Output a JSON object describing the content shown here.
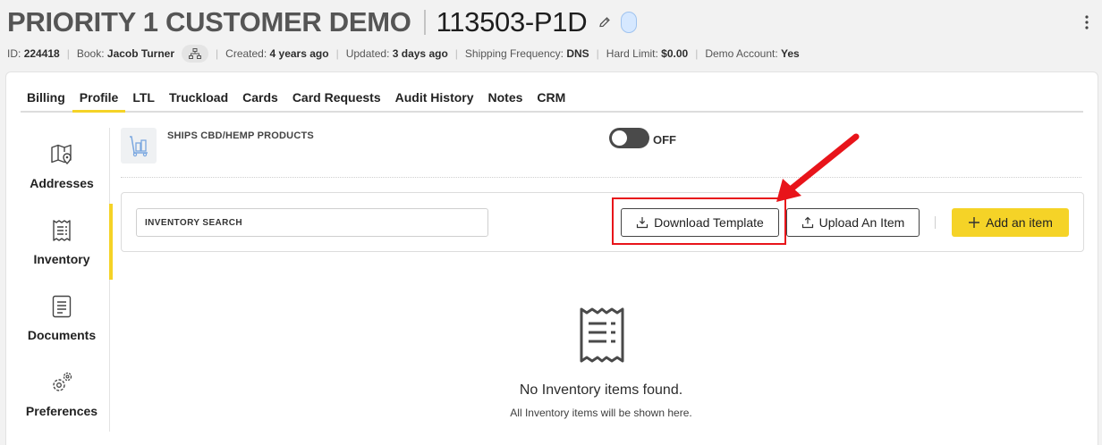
{
  "header": {
    "account_name": "PRIORITY 1 CUSTOMER DEMO",
    "account_code": "113503-P1D",
    "meta": [
      {
        "label": "ID:",
        "value": "224418"
      },
      {
        "label": "Book:",
        "value": "Jacob Turner"
      },
      {
        "label": "Created:",
        "value": "4 years ago"
      },
      {
        "label": "Updated:",
        "value": "3 days ago"
      },
      {
        "label": "Shipping Frequency:",
        "value": "DNS"
      },
      {
        "label": "Hard Limit:",
        "value": "$0.00"
      },
      {
        "label": "Demo Account:",
        "value": "Yes"
      }
    ]
  },
  "tabs": [
    "Billing",
    "Profile",
    "LTL",
    "Truckload",
    "Cards",
    "Card Requests",
    "Audit History",
    "Notes",
    "CRM"
  ],
  "active_tab": "Profile",
  "side_nav": [
    {
      "label": "Addresses",
      "icon": "map-pin-icon"
    },
    {
      "label": "Inventory",
      "icon": "receipt-icon"
    },
    {
      "label": "Documents",
      "icon": "document-icon"
    },
    {
      "label": "Preferences",
      "icon": "gears-icon"
    }
  ],
  "active_nav": "Inventory",
  "cbd": {
    "label": "SHIPS CBD/HEMP PRODUCTS",
    "toggle_state": "OFF",
    "icon": "hand-truck-icon"
  },
  "toolbar": {
    "search_placeholder": "INVENTORY SEARCH",
    "download_label": "Download Template",
    "upload_label": "Upload An Item",
    "add_label": "Add an item"
  },
  "empty_state": {
    "title": "No Inventory items found.",
    "subtitle": "All Inventory items will be shown here."
  },
  "colors": {
    "accent": "#f5d327",
    "annotation": "#e8141a",
    "pill": "#d6e8ff"
  }
}
